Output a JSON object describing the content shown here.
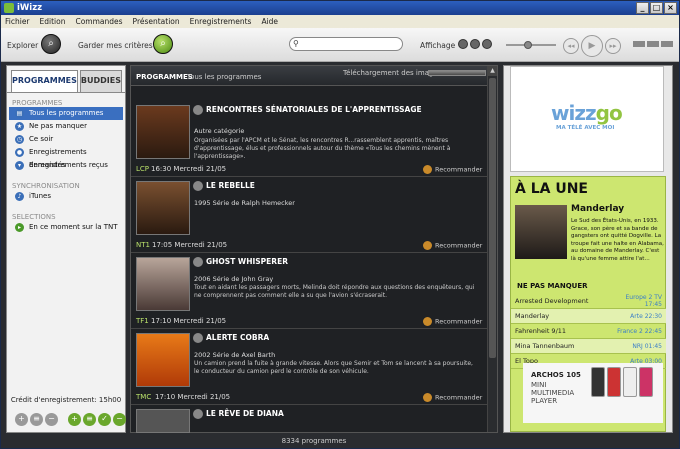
{
  "window": {
    "title": "iWizz",
    "buttons": [
      "_",
      "□",
      "×"
    ]
  },
  "menu": [
    "Fichier",
    "Edition",
    "Commandes",
    "Présentation",
    "Enregistrements",
    "Aide"
  ],
  "toolbar": {
    "explorer_label": "Explorer",
    "save_criteria_label": "Garder mes critères",
    "search_placeholder": "",
    "display_label": "Affichage"
  },
  "left": {
    "tabs": [
      "PROGRAMMES",
      "BUDDIES"
    ],
    "sections": {
      "programmes": "PROGRAMMES",
      "sync": "SYNCHRONISATION",
      "selections": "SELECTIONS"
    },
    "programmes_items": [
      "Tous les programmes",
      "Ne pas manquer",
      "Ce soir",
      "Enregistrements demandés",
      "Enregistrements reçus"
    ],
    "sync_items": [
      "iTunes"
    ],
    "selection_items": [
      "En ce moment sur la TNT"
    ],
    "credit": "Crédit d'enregistrement: 15h00"
  },
  "center": {
    "header_title": "PROGRAMMES",
    "header_sub": "Tous les programmes",
    "download_label": "Téléchargement des images",
    "download_progress": 1.0,
    "status": "8334 programmes",
    "recommend_label": "Recommander",
    "programs": [
      {
        "title": "RENCONTRES SÉNATORIALES DE L'APPRENTISSAGE",
        "subtitle": "Autre catégorie",
        "desc": "Organisées par l'APCM et le Sénat, les rencontres R...rassemblent apprentis, maîtres d'apprentissage, élus et professionnels autour du thème «Tous les chemins mènent à l'apprentissage».",
        "channel": "LCP",
        "time": "16:30 Mercredi 21/05"
      },
      {
        "title": "LE REBELLE",
        "subtitle": "1995 Série de Ralph Hemecker",
        "desc": "",
        "channel": "NT1",
        "time": "17:05 Mercredi 21/05"
      },
      {
        "title": "GHOST WHISPERER",
        "subtitle": "2006 Série de John Gray",
        "desc": "Tout en aidant les passagers morts, Melinda doit répondre aux questions des enquêteurs, qui ne comprennent pas comment elle a su que l'avion s'écraserait.",
        "channel": "TF1",
        "time": "17:10 Mercredi 21/05"
      },
      {
        "title": "ALERTE COBRA",
        "subtitle": "2002 Série de Axel Barth",
        "desc": "Un camion prend la fuite à grande vitesse. Alors que Semir et Tom se lancent à sa poursuite, le conducteur du camion perd le contrôle de son véhicule.",
        "channel": "TMC",
        "time": "17:10 Mercredi 21/05"
      },
      {
        "title": "LE RÊVE DE DIANA",
        "subtitle": "",
        "desc": "",
        "channel": "",
        "time": ""
      }
    ]
  },
  "right": {
    "logo_w": "wizz",
    "logo_g": "go",
    "tagline": "MA TÉLÉ AVEC MOI",
    "une_title": "À LA UNE",
    "une_movie": "Manderlay",
    "une_desc": "Le Sud des États-Unis, en 1933. Grace, son père et sa bande de gangsters ont quitté Dogville. La troupe fait une halte en Alabama, au domaine de Manderlay. C'est là qu'une femme attire l'at...",
    "np_title": "NE PAS MANQUER",
    "np_rows": [
      {
        "name": "Arrested Development",
        "ch": "Europe 2 TV 17:45"
      },
      {
        "name": "Manderlay",
        "ch": "Arte 22:30"
      },
      {
        "name": "Fahrenheit 9/11",
        "ch": "France 2 22:45"
      },
      {
        "name": "Mina Tannenbaum",
        "ch": "NRJ 01:45"
      },
      {
        "name": "El Topo",
        "ch": "Arte 03:00"
      }
    ],
    "ad_brand": "ARCHOS 105",
    "ad_text": "MINI MULTIMEDIA PLAYER"
  }
}
